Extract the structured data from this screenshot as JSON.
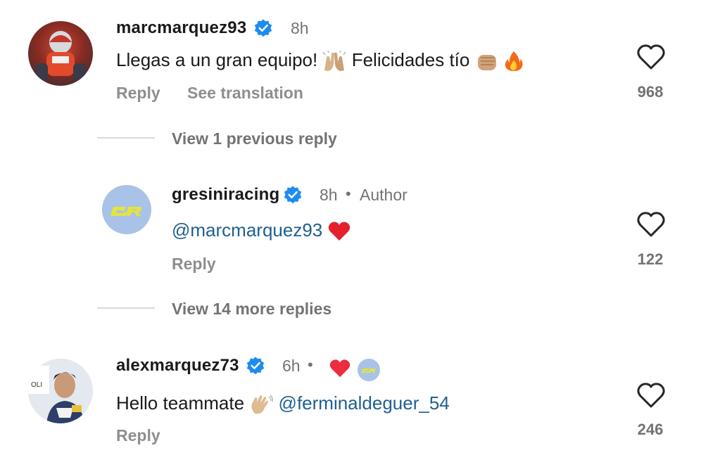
{
  "comments": [
    {
      "username": "marcmarquez93",
      "time": "8h",
      "text": "Llegas a un gran equipo!",
      "text2": " Felicidades tío",
      "reply_label": "Reply",
      "translate_label": "See translation",
      "likes": "968",
      "icons": [
        "verified-badge-icon",
        "raising-hands-icon",
        "fist-icon",
        "fire-icon",
        "heart-outline-icon"
      ]
    },
    {
      "username": "gresiniracing",
      "time": "8h",
      "author_label": "Author",
      "mention": "@marcmarquez93",
      "reply_label": "Reply",
      "likes": "122",
      "icons": [
        "verified-badge-icon",
        "red-heart-icon",
        "heart-outline-icon"
      ]
    },
    {
      "username": "alexmarquez73",
      "time": "6h",
      "text": "Hello teammate",
      "mention": "@ferminaldeguer_54",
      "reply_label": "Reply",
      "likes": "246",
      "icons": [
        "verified-badge-icon",
        "liked-by-creator-heart-icon",
        "waving-hand-icon",
        "heart-outline-icon"
      ]
    }
  ],
  "threads": {
    "previous_replies": "View 1 previous reply",
    "more_replies": "View 14 more replies"
  },
  "colors": {
    "verified": "#1d8cf0",
    "mention": "#1f5f91",
    "gresini_avatar": "#a9c3e8",
    "gresini_logo": "#e6e43a",
    "heart_red": "#ed2c3f"
  }
}
